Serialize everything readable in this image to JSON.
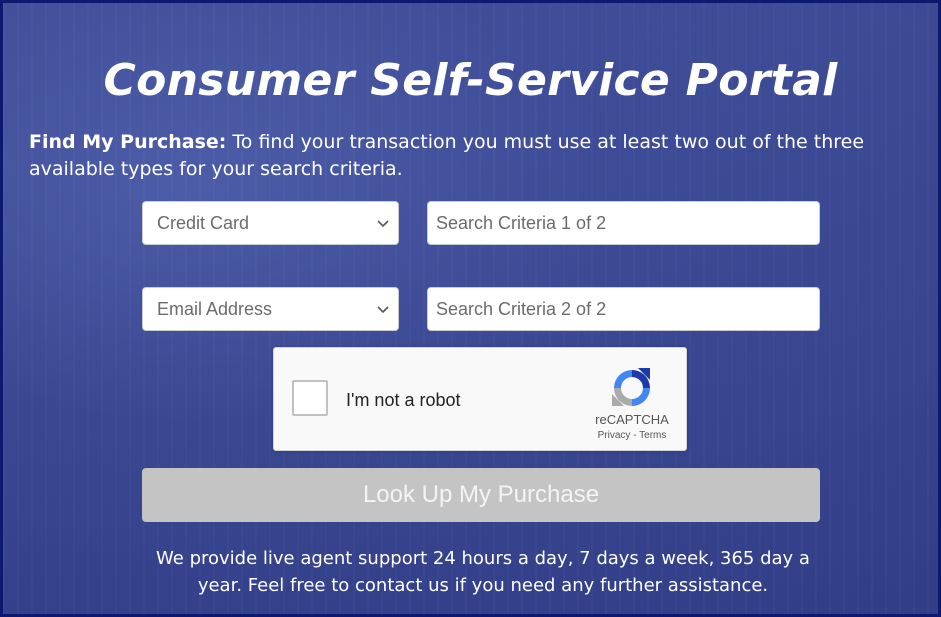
{
  "header": {
    "title": "Consumer Self-Service Portal"
  },
  "intro": {
    "label": "Find My Purchase:",
    "text": " To find your transaction you must use at least two out of the three available types for your search criteria."
  },
  "search": {
    "type1": {
      "selected": "Credit Card"
    },
    "criteria1": {
      "placeholder": "Search Criteria 1 of 2"
    },
    "type2": {
      "selected": "Email Address"
    },
    "criteria2": {
      "placeholder": "Search Criteria 2 of 2"
    }
  },
  "captcha": {
    "label": "I'm not a robot",
    "brand": "reCAPTCHA",
    "links": "Privacy - Terms",
    "checked": false
  },
  "lookup_button": {
    "label": "Look Up My Purchase",
    "enabled": false
  },
  "support_text": "We provide live agent support 24 hours a day, 7 days a week, 365 day a year. Feel free to contact us if you need any further assistance.",
  "icons": {
    "dropdown": "chevron-down-icon",
    "captcha": "recaptcha-logo-icon"
  },
  "colors": {
    "background": "#3a4896",
    "border": "#0b1a6e",
    "button_disabled": "#c4c4c4"
  }
}
